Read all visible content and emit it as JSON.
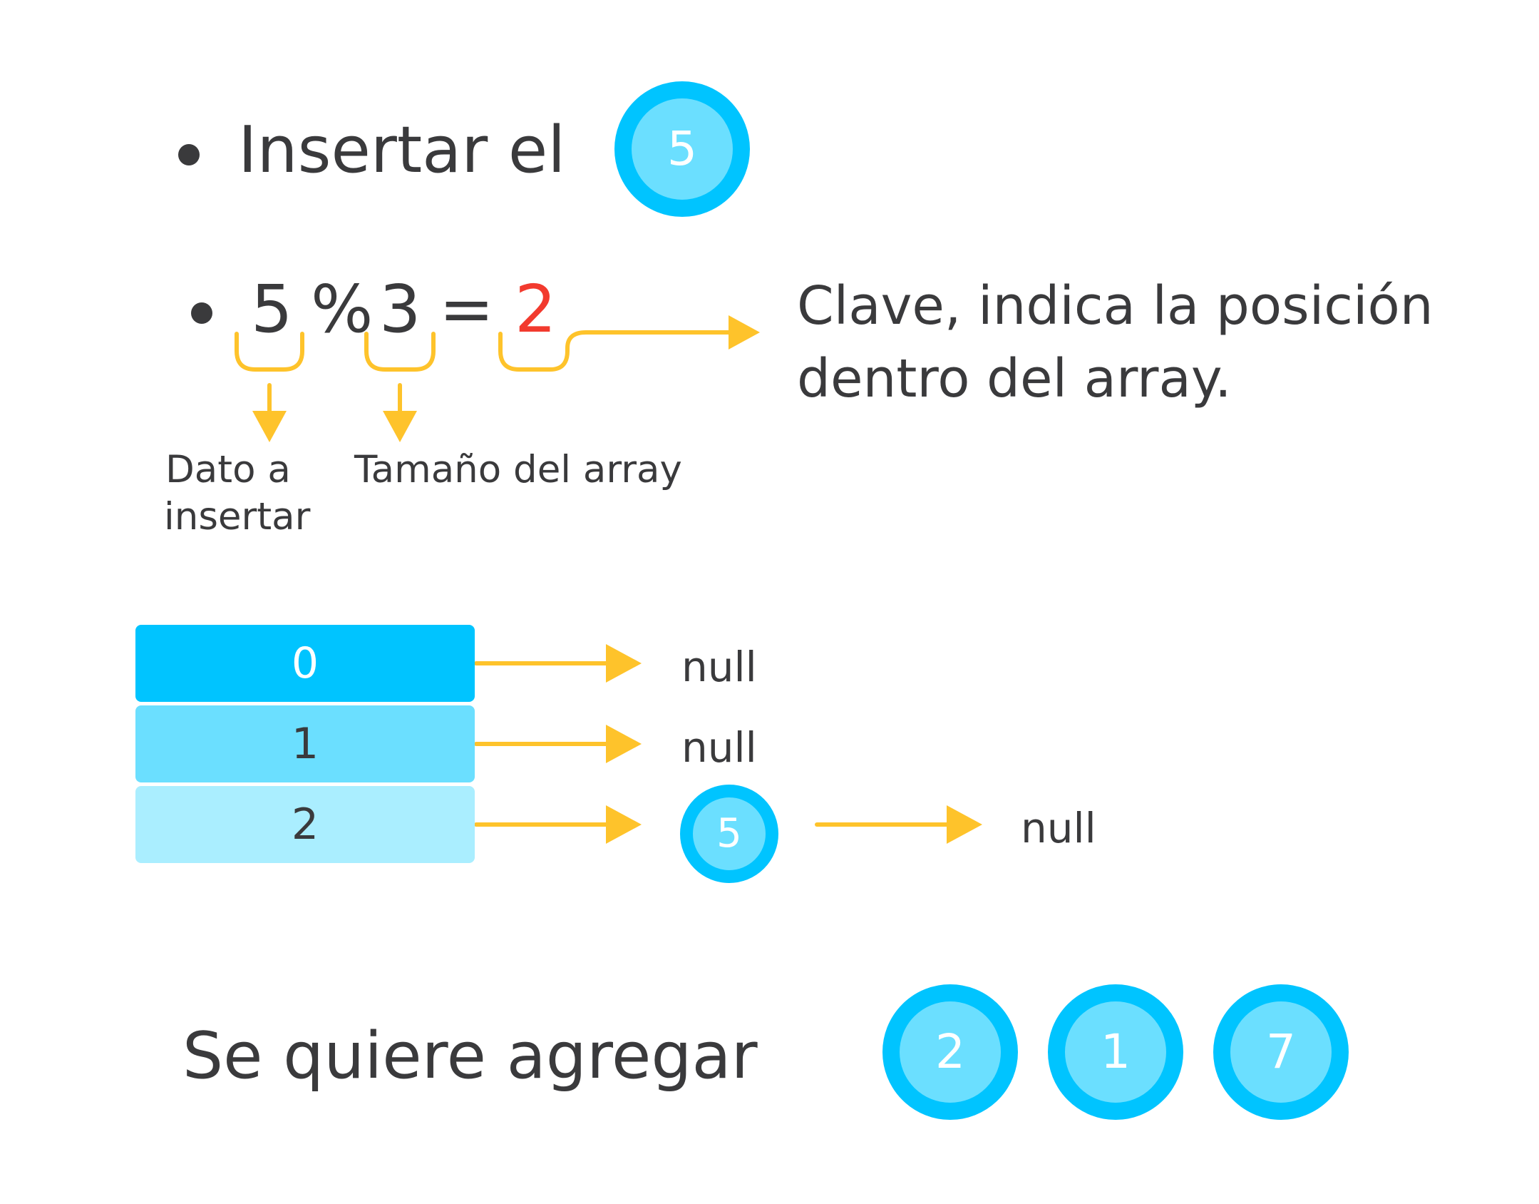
{
  "colors": {
    "text": "#3a3a3c",
    "accent_arrow": "#fec32b",
    "result_red": "#f23a2e",
    "circle_fill": "#6bdfff",
    "circle_ring": "#00c4ff",
    "cell0": "#00c4ff",
    "cell1": "#6bdfff",
    "cell2": "#aaeeff"
  },
  "step1": {
    "label": "Insertar el",
    "value": "5"
  },
  "formula": {
    "dividend": "5",
    "operator": "%",
    "divisor": "3",
    "equals": "=",
    "result": "2",
    "dividend_caption_line1": "Dato a",
    "dividend_caption_line2": "insertar",
    "divisor_caption": "Tamaño del array",
    "result_caption_line1": "Clave, indica la posición",
    "result_caption_line2": "dentro del array."
  },
  "table": {
    "rows": [
      {
        "index": "0",
        "chain": [],
        "terminal": "null"
      },
      {
        "index": "1",
        "chain": [],
        "terminal": "null"
      },
      {
        "index": "2",
        "chain": [
          "5"
        ],
        "terminal": "null"
      }
    ]
  },
  "pending": {
    "label": "Se quiere agregar",
    "values": [
      "2",
      "1",
      "7"
    ]
  },
  "icons": [
    "bullet-icon",
    "arrow-right-icon",
    "arrow-down-icon",
    "brace-icon"
  ]
}
